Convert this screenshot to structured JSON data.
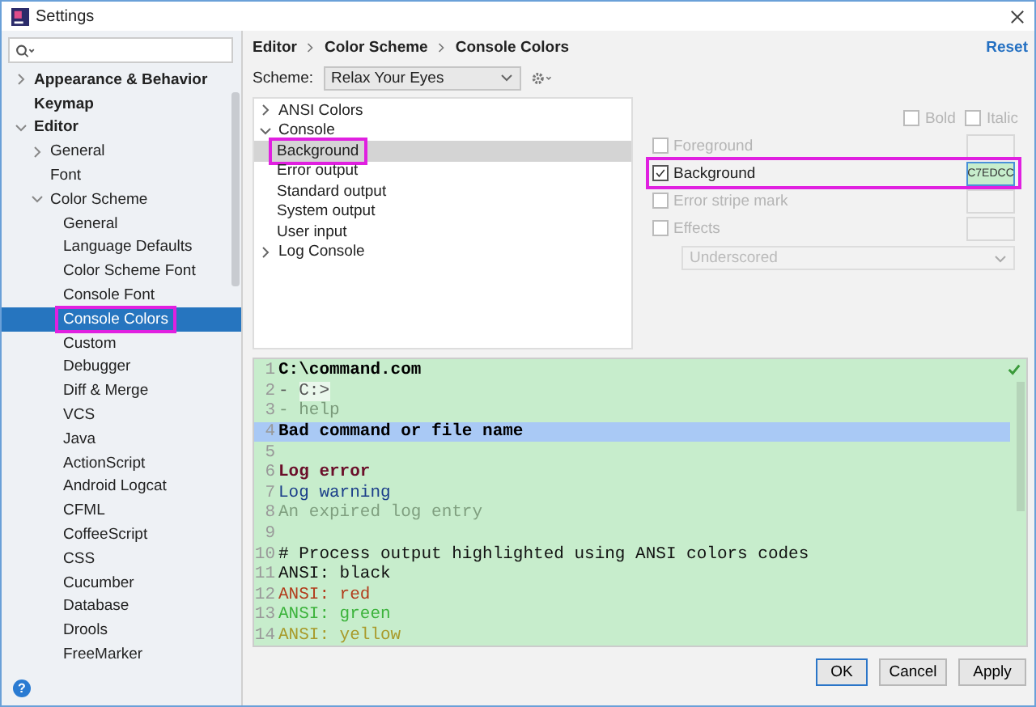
{
  "window": {
    "title": "Settings"
  },
  "sidebar": {
    "items": [
      {
        "label": "Appearance & Behavior",
        "expanded": false,
        "selected": false,
        "highlighted": false
      },
      {
        "label": "Keymap",
        "selected": false,
        "highlighted": false
      },
      {
        "label": "Editor",
        "expanded": true,
        "selected": false,
        "highlighted": false,
        "children": [
          {
            "label": "General",
            "expanded": false,
            "selected": false,
            "highlighted": false
          },
          {
            "label": "Font",
            "selected": false,
            "highlighted": false
          },
          {
            "label": "Color Scheme",
            "expanded": true,
            "selected": false,
            "highlighted": false,
            "children": [
              {
                "label": "General",
                "selected": false,
                "highlighted": false
              },
              {
                "label": "Language Defaults",
                "selected": false,
                "highlighted": false
              },
              {
                "label": "Color Scheme Font",
                "selected": false,
                "highlighted": false
              },
              {
                "label": "Console Font",
                "selected": false,
                "highlighted": false
              },
              {
                "label": "Console Colors",
                "selected": true,
                "highlighted": true
              },
              {
                "label": "Custom",
                "selected": false,
                "highlighted": false
              },
              {
                "label": "Debugger",
                "selected": false,
                "highlighted": false
              },
              {
                "label": "Diff & Merge",
                "selected": false,
                "highlighted": false
              },
              {
                "label": "VCS",
                "selected": false,
                "highlighted": false
              },
              {
                "label": "Java",
                "selected": false,
                "highlighted": false
              },
              {
                "label": "ActionScript",
                "selected": false,
                "highlighted": false
              },
              {
                "label": "Android Logcat",
                "selected": false,
                "highlighted": false
              },
              {
                "label": "CFML",
                "selected": false,
                "highlighted": false
              },
              {
                "label": "CoffeeScript",
                "selected": false,
                "highlighted": false
              },
              {
                "label": "CSS",
                "selected": false,
                "highlighted": false
              },
              {
                "label": "Cucumber",
                "selected": false,
                "highlighted": false
              },
              {
                "label": "Database",
                "selected": false,
                "highlighted": false
              },
              {
                "label": "Drools",
                "selected": false,
                "highlighted": false
              },
              {
                "label": "FreeMarker",
                "selected": false,
                "highlighted": false
              }
            ]
          }
        ]
      }
    ],
    "help": "?"
  },
  "breadcrumb": [
    "Editor",
    "Color Scheme",
    "Console Colors"
  ],
  "reset": "Reset",
  "scheme": {
    "label": "Scheme:",
    "value": "Relax Your Eyes"
  },
  "tree": [
    {
      "label": "ANSI Colors",
      "expanded": false,
      "selected": false,
      "highlighted": false
    },
    {
      "label": "Console",
      "expanded": true,
      "selected": false,
      "highlighted": false,
      "children": [
        {
          "label": "Background",
          "selected": true,
          "highlighted": true
        },
        {
          "label": "Error output",
          "selected": false,
          "highlighted": false
        },
        {
          "label": "Standard output",
          "selected": false,
          "highlighted": false
        },
        {
          "label": "System output",
          "selected": false,
          "highlighted": false
        },
        {
          "label": "User input",
          "selected": false,
          "highlighted": false
        }
      ]
    },
    {
      "label": "Log Console",
      "expanded": false,
      "selected": false,
      "highlighted": false
    }
  ],
  "attributes": {
    "styles": [
      {
        "label": "Bold",
        "checked": false,
        "disabled": true
      },
      {
        "label": "Italic",
        "checked": false,
        "disabled": true
      }
    ],
    "options": [
      {
        "label": "Foreground",
        "checked": false,
        "disabled": true,
        "highlighted": false
      },
      {
        "label": "Background",
        "checked": true,
        "disabled": false,
        "highlighted": true,
        "value": "C7EDCC",
        "color": "#c7edcc"
      },
      {
        "label": "Error stripe mark",
        "checked": false,
        "disabled": true,
        "highlighted": false
      },
      {
        "label": "Effects",
        "checked": false,
        "disabled": true,
        "highlighted": false
      }
    ],
    "effect_type": {
      "value": "Underscored",
      "disabled": true
    }
  },
  "preview": {
    "lines": [
      {
        "number": "1",
        "text": "C:\\command.com",
        "kind": "stdout",
        "current": false
      },
      {
        "number": "2",
        "text": "- C:>",
        "kind": "input",
        "current": false
      },
      {
        "number": "3",
        "text": "- help",
        "kind": "system",
        "current": false
      },
      {
        "number": "4",
        "text": "Bad command or file name",
        "kind": "stdout",
        "current": true
      },
      {
        "number": "5",
        "current": false
      },
      {
        "number": "6",
        "text": "Log error",
        "kind": "log-error",
        "current": false
      },
      {
        "number": "7",
        "text": "Log warning",
        "kind": "log-warning",
        "current": false
      },
      {
        "number": "8",
        "text": "An expired log entry",
        "kind": "expired",
        "current": false
      },
      {
        "number": "9",
        "current": false
      },
      {
        "number": "10",
        "text": "# Process output highlighted using ANSI colors codes",
        "kind": "plain",
        "current": false
      },
      {
        "number": "11",
        "text": "ANSI: black",
        "kind": "ansi-black",
        "current": false
      },
      {
        "number": "12",
        "text": "ANSI: red",
        "kind": "ansi-red",
        "current": false
      },
      {
        "number": "13",
        "text": "ANSI: green",
        "kind": "ansi-green",
        "current": false
      },
      {
        "number": "14",
        "text": "ANSI: yellow",
        "kind": "ansi-yellow",
        "current": false
      }
    ]
  },
  "buttons": [
    {
      "label": "OK",
      "default": true
    },
    {
      "label": "Cancel",
      "default": false
    },
    {
      "label": "Apply",
      "default": false
    }
  ]
}
